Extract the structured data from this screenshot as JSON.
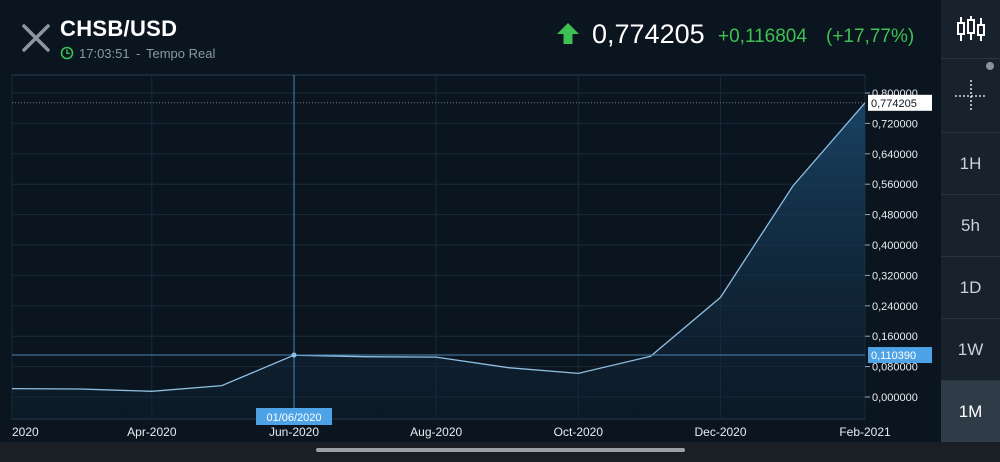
{
  "header": {
    "symbol": "CHSB/USD",
    "time": "17:03:51",
    "time_separator": "-",
    "time_label": "Tempo Real",
    "price": "0,774205",
    "change": "+0,116804",
    "change_pct": "(+17,77%)"
  },
  "colors": {
    "background": "#0b1520",
    "line": "#8fbfe0",
    "positive": "#3ec152",
    "badge": "#4da3e6"
  },
  "toolbar": {
    "timeframes": [
      "1H",
      "5h",
      "1D",
      "1W",
      "1M"
    ],
    "selected": "1M",
    "icons": [
      "candlestick-chart-icon",
      "crosshair-icon"
    ]
  },
  "chart_data": {
    "type": "area",
    "x": [
      "2020-02-01",
      "2020-03-01",
      "2020-04-01",
      "2020-05-01",
      "2020-06-01",
      "2020-07-01",
      "2020-08-01",
      "2020-09-01",
      "2020-10-01",
      "2020-11-01",
      "2020-12-01",
      "2021-01-01",
      "2021-02-01"
    ],
    "values": [
      0.022,
      0.021,
      0.015,
      0.03,
      0.11,
      0.106,
      0.105,
      0.077,
      0.062,
      0.107,
      0.262,
      0.555,
      0.774205
    ],
    "ylim": [
      0,
      0.8
    ],
    "yticks": [
      "0,000000",
      "0,080000",
      "0,160000",
      "0,240000",
      "0,320000",
      "0,400000",
      "0,480000",
      "0,560000",
      "0,640000",
      "0,720000",
      "0,800000"
    ],
    "xticks": [
      {
        "date": "2020-02-01",
        "label": "2020"
      },
      {
        "date": "2020-04-01",
        "label": "Apr-2020"
      },
      {
        "date": "2020-06-01",
        "label": "Jun-2020"
      },
      {
        "date": "2020-08-01",
        "label": "Aug-2020"
      },
      {
        "date": "2020-10-01",
        "label": "Oct-2020"
      },
      {
        "date": "2020-12-01",
        "label": "Dec-2020"
      },
      {
        "date": "2021-02-01",
        "label": "Feb-2021"
      }
    ],
    "last_value": 0.774205,
    "last_label": "0,774205",
    "crosshair": {
      "date": "2020-06-01",
      "value": 0.11039,
      "date_label": "01/06/2020",
      "value_label": "0,110390"
    },
    "grid": true
  }
}
